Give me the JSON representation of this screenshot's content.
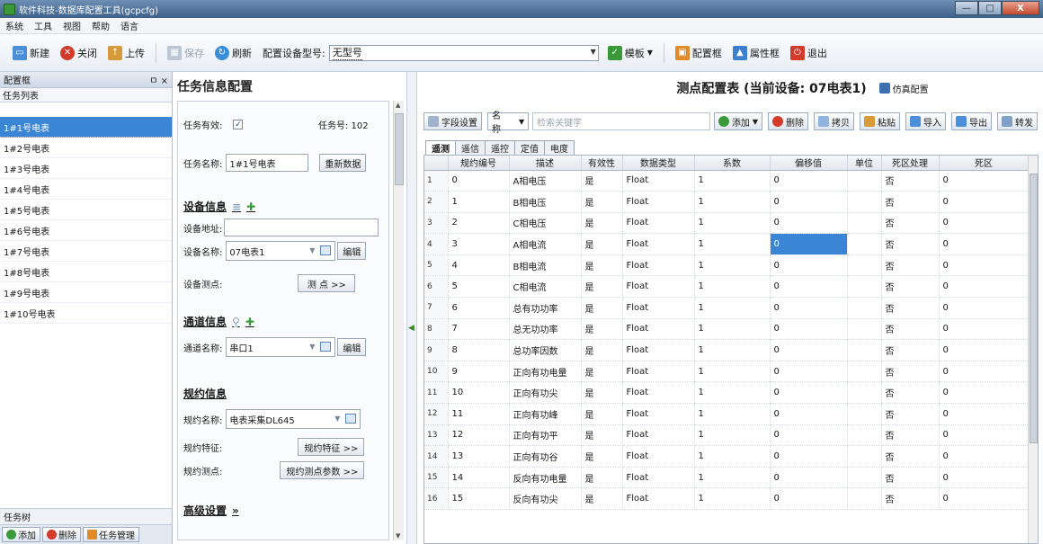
{
  "window": {
    "title": "软件科技-数据库配置工具(gcpcfg)",
    "buttons": [
      "—",
      "□",
      "X"
    ]
  },
  "menu": [
    "系统",
    "工具",
    "视图",
    "帮助",
    "语言"
  ],
  "toolbar": {
    "new_label": "新建",
    "close_label": "关闭",
    "upload_label": "上传",
    "save_label": "保存",
    "refresh_label": "刷新",
    "device_type_label": "配置设备型号:",
    "device_type_value": "无型号",
    "template_label": "模板",
    "config_box_label": "配置框",
    "property_box_label": "属性框",
    "exit_label": "退出"
  },
  "left_panel": {
    "header": "配置框",
    "header_pin": "ㅁ ×",
    "sub_header": "任务列表",
    "tasks": [
      "1#1号电表",
      "1#2号电表",
      "1#3号电表",
      "1#4号电表",
      "1#5号电表",
      "1#6号电表",
      "1#7号电表",
      "1#8号电表",
      "1#9号电表",
      "1#10号电表"
    ],
    "selected_index": 0,
    "bottom_tab": "任务树",
    "add_label": "添加",
    "delete_label": "删除",
    "manage_label": "任务管理"
  },
  "task_config": {
    "title": "任务信息配置",
    "task_valid_label": "任务有效:",
    "task_valid_checked": "✓",
    "task_no_label": "任务号: 102",
    "task_name_label": "任务名称:",
    "task_name_value": "1#1号电表",
    "reconfig_button": "重新数据",
    "device_section": "设备信息",
    "device_addr_label": "设备地址:",
    "device_addr_value": "",
    "device_name_label": "设备名称:",
    "device_name_value": "07电表1",
    "edit_button": "编辑",
    "device_points_label": "设备测点:",
    "points_button": "测 点 >>",
    "channel_section": "通道信息",
    "channel_name_label": "通道名称:",
    "channel_name_value": "串口1",
    "channel_edit_button": "编辑",
    "protocol_section": "规约信息",
    "protocol_name_label": "规约名称:",
    "protocol_name_value": "电表采集DL645",
    "protocol_feature_label": "规约特征:",
    "protocol_feature_button": "规约特征 >>",
    "protocol_points_label": "规约测点:",
    "protocol_points_button": "规约测点参数 >>",
    "advanced_section": "高级设置",
    "advanced_icon": "»"
  },
  "point_config": {
    "title": "测点配置表 (当前设备: 07电表1)",
    "fill_link": "仿真配置",
    "field_settings_button": "字段设置",
    "search_field": "名称",
    "search_placeholder": "检索关键字",
    "add_button": "添加",
    "delete_button": "删除",
    "copy_button": "拷贝",
    "paste_button": "粘贴",
    "import_button": "导入",
    "export_button": "导出",
    "forward_button": "转发",
    "tabs": [
      "遥测",
      "遥信",
      "遥控",
      "定值",
      "电度"
    ],
    "active_tab": 0,
    "columns": [
      "",
      "规约编号",
      "描述",
      "有效性",
      "数据类型",
      "系数",
      "偏移值",
      "单位",
      "死区处理",
      "死区"
    ],
    "rows": [
      [
        "1",
        "0",
        "A相电压",
        "是",
        "Float",
        "1",
        "0",
        "",
        "否",
        "0"
      ],
      [
        "2",
        "1",
        "B相电压",
        "是",
        "Float",
        "1",
        "0",
        "",
        "否",
        "0"
      ],
      [
        "3",
        "2",
        "C相电压",
        "是",
        "Float",
        "1",
        "0",
        "",
        "否",
        "0"
      ],
      [
        "4",
        "3",
        "A相电流",
        "是",
        "Float",
        "1",
        "0",
        "",
        "否",
        "0"
      ],
      [
        "5",
        "4",
        "B相电流",
        "是",
        "Float",
        "1",
        "0",
        "",
        "否",
        "0"
      ],
      [
        "6",
        "5",
        "C相电流",
        "是",
        "Float",
        "1",
        "0",
        "",
        "否",
        "0"
      ],
      [
        "7",
        "6",
        "总有功功率",
        "是",
        "Float",
        "1",
        "0",
        "",
        "否",
        "0"
      ],
      [
        "8",
        "7",
        "总无功功率",
        "是",
        "Float",
        "1",
        "0",
        "",
        "否",
        "0"
      ],
      [
        "9",
        "8",
        "总功率因数",
        "是",
        "Float",
        "1",
        "0",
        "",
        "否",
        "0"
      ],
      [
        "10",
        "9",
        "正向有功电量",
        "是",
        "Float",
        "1",
        "0",
        "",
        "否",
        "0"
      ],
      [
        "11",
        "10",
        "正向有功尖",
        "是",
        "Float",
        "1",
        "0",
        "",
        "否",
        "0"
      ],
      [
        "12",
        "11",
        "正向有功峰",
        "是",
        "Float",
        "1",
        "0",
        "",
        "否",
        "0"
      ],
      [
        "13",
        "12",
        "正向有功平",
        "是",
        "Float",
        "1",
        "0",
        "",
        "否",
        "0"
      ],
      [
        "14",
        "13",
        "正向有功谷",
        "是",
        "Float",
        "1",
        "0",
        "",
        "否",
        "0"
      ],
      [
        "15",
        "14",
        "反向有功电量",
        "是",
        "Float",
        "1",
        "0",
        "",
        "否",
        "0"
      ],
      [
        "16",
        "15",
        "反向有功尖",
        "是",
        "Float",
        "1",
        "0",
        "",
        "否",
        "0"
      ]
    ],
    "selected_cell": [
      3,
      6
    ]
  },
  "colors": {
    "accent": "#3b85d6",
    "close_red": "#d23a2a",
    "add_green": "#3a9a3a"
  }
}
